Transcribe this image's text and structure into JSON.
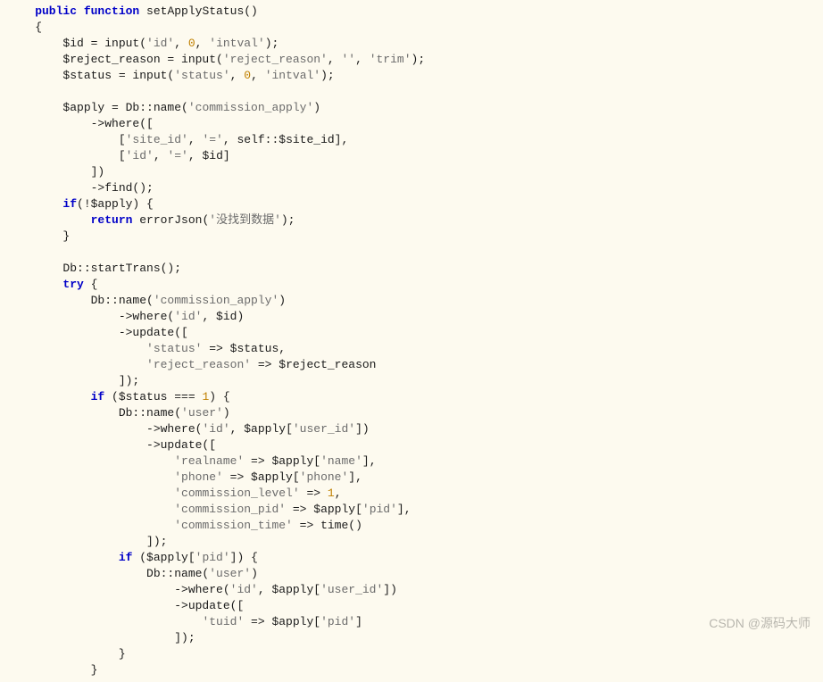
{
  "code": {
    "l01": "    public function setApplyStatus()",
    "l02": "    {",
    "l03a": "        $id = input(",
    "l03s1": "'id'",
    "l03n": "0",
    "l03s2": "'intval'",
    "l04a": "        $reject_reason = input(",
    "l04s1": "'reject_reason'",
    "l04s2": "''",
    "l04s3": "'trim'",
    "l05a": "        $status = input(",
    "l05s1": "'status'",
    "l05n": "0",
    "l05s2": "'intval'",
    "l07a": "        $apply = Db::name(",
    "l07s": "'commission_apply'",
    "l08": "            ->where([",
    "l09a": "                [",
    "l09s": "'site_id'",
    "l09s2": "'='",
    "l09b": ", self::$site_id],",
    "l10a": "                [",
    "l10s": "'id'",
    "l10s2": "'='",
    "l10b": ", $id]",
    "l11": "            ])",
    "l12": "            ->find();",
    "l13": "        if(!$apply) {",
    "l14a": "            return errorJson(",
    "l14s": "'没找到数据'",
    "l15": "        }",
    "l17": "        Db::startTrans();",
    "l18": "        try {",
    "l19a": "            Db::name(",
    "l19s": "'commission_apply'",
    "l20a": "                ->where(",
    "l20s": "'id'",
    "l20b": ", $id)",
    "l21": "                ->update([",
    "l22a": "                    ",
    "l22s": "'status'",
    "l22b": " => $status,",
    "l23a": "                    ",
    "l23s": "'reject_reason'",
    "l23b": " => $reject_reason",
    "l24": "                ]);",
    "l25a": "            if ($status === ",
    "l25n": "1",
    "l25b": ") {",
    "l26a": "                Db::name(",
    "l26s": "'user'",
    "l27a": "                    ->where(",
    "l27s": "'id'",
    "l27b": ", $apply[",
    "l27s2": "'user_id'",
    "l27c": "])",
    "l28": "                    ->update([",
    "l29a": "                        ",
    "l29s": "'realname'",
    "l29b": " => $apply[",
    "l29s2": "'name'",
    "l29c": "],",
    "l30a": "                        ",
    "l30s": "'phone'",
    "l30b": " => $apply[",
    "l30s2": "'phone'",
    "l30c": "],",
    "l31a": "                        ",
    "l31s": "'commission_level'",
    "l31b": " => ",
    "l31n": "1",
    "l31c": ",",
    "l32a": "                        ",
    "l32s": "'commission_pid'",
    "l32b": " => $apply[",
    "l32s2": "'pid'",
    "l32c": "],",
    "l33a": "                        ",
    "l33s": "'commission_time'",
    "l33b": " => time()",
    "l34": "                    ]);",
    "l35a": "                if ($apply[",
    "l35s": "'pid'",
    "l35b": "]) {",
    "l36a": "                    Db::name(",
    "l36s": "'user'",
    "l37a": "                        ->where(",
    "l37s": "'id'",
    "l37b": ", $apply[",
    "l37s2": "'user_id'",
    "l37c": "])",
    "l38": "                        ->update([",
    "l39a": "                            ",
    "l39s": "'tuid'",
    "l39b": " => $apply[",
    "l39s2": "'pid'",
    "l39c": "]",
    "l40": "                        ]);",
    "l41": "                }",
    "l42": "            }"
  },
  "watermark": "CSDN @源码大师"
}
